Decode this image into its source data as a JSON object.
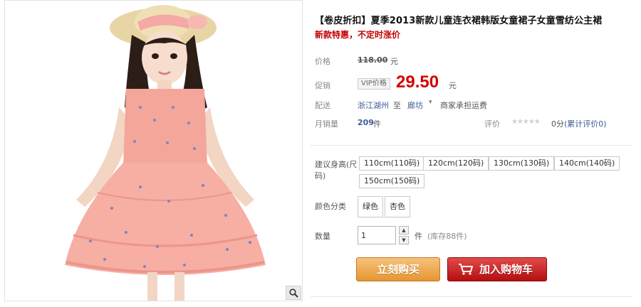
{
  "product": {
    "title": "【卷皮折扣】夏季2013新款儿童连衣裙韩版女童裙子女童雪纺公主裙",
    "promo": "新款特惠，不定时涨价"
  },
  "pricing": {
    "orig_label": "价格",
    "orig_price": "118.00",
    "orig_unit": "元",
    "promo_label": "促销",
    "vip_tag": "VIP价格",
    "sale_price": "29.50",
    "sale_unit": "元"
  },
  "shipping": {
    "label": "配送",
    "from": "浙江湖州",
    "to_word": "至",
    "to": "廊坊",
    "note": "商家承担运费"
  },
  "sales": {
    "label": "月销量",
    "count": "209",
    "unit": "件",
    "review_label": "评价",
    "review_score": "0分",
    "review_link": "(累计评价0)",
    "stars": "★★★★★"
  },
  "sizes": {
    "label": "建议身高(尺码)",
    "options": [
      "110cm(110码)",
      "120cm(120码)",
      "130cm(130码)",
      "140cm(140码)",
      "150cm(150码)"
    ]
  },
  "colors": {
    "label": "颜色分类",
    "options": [
      "绿色",
      "杏色"
    ]
  },
  "quantity": {
    "label": "数量",
    "value": "1",
    "unit": "件",
    "stock": "(库存88件)"
  },
  "actions": {
    "buy_now": "立刻购买",
    "add_cart": "加入购物车"
  },
  "icons": {
    "zoom": "magnifier-icon",
    "cart": "shopping-cart-icon",
    "up": "chevron-up-icon",
    "down": "chevron-down-icon"
  },
  "colors_theme": {
    "price_red": "#d40000",
    "buy_orange": "#e69632",
    "cart_red": "#b40f0f"
  }
}
